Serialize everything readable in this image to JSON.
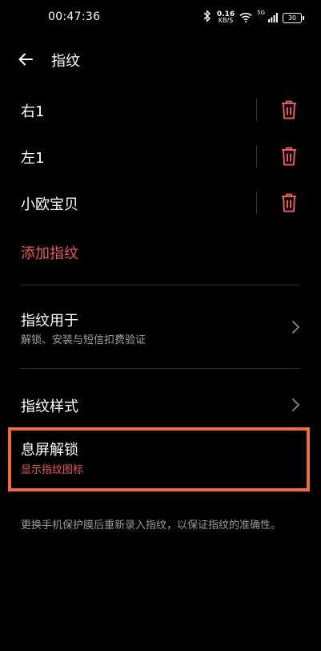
{
  "status_bar": {
    "time": "00:47:36",
    "net_speed_value": "0.16",
    "net_speed_unit": "KB/S",
    "signal_label": "5G",
    "battery": "30",
    "icons": [
      "bluetooth-icon",
      "wifi-icon",
      "signal-icon",
      "battery-icon"
    ]
  },
  "header": {
    "title": "指纹"
  },
  "fingerprints": [
    {
      "label": "右1"
    },
    {
      "label": "左1"
    },
    {
      "label": "小欧宝贝"
    }
  ],
  "add_fingerprint": "添加指纹",
  "menu": {
    "usage": {
      "title": "指纹用于",
      "subtitle": "解锁、安装与短信扣费验证"
    },
    "style": {
      "title": "指纹样式"
    },
    "screen_off": {
      "title": "息屏解锁",
      "subtitle": "显示指纹图标"
    }
  },
  "note": "更换手机保护膜后重新录入指纹，以保证指纹的准确性。",
  "colors": {
    "background": "#000000",
    "accent_red": "#e8585c",
    "highlight_orange": "#f26a3a"
  }
}
